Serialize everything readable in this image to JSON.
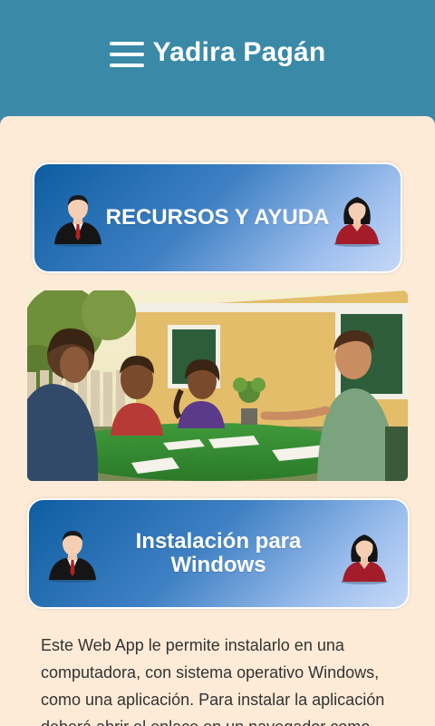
{
  "header": {
    "title": "Yadira Pagán",
    "menu_icon": "menu-icon",
    "background": "#3a89a7"
  },
  "buttons": {
    "resources": {
      "label": "RECURSOS Y AYUDA",
      "left_icon": "man-avatar-icon",
      "right_icon": "woman-avatar-icon"
    },
    "windows": {
      "label": "Instalación para Windows",
      "left_icon": "man-avatar-icon",
      "right_icon": "woman-avatar-icon"
    }
  },
  "image": {
    "name": "family-study-scene-image"
  },
  "description": {
    "text": "Este Web App le permite instalarlo en una computadora, con sistema operativo Windows, como una aplicación. Para instalar la aplicación deberá abrir el enlace en un navegador como"
  },
  "colors": {
    "page_background": "#fdebd7",
    "button_gradient_start": "#0e5da1",
    "button_gradient_end": "#c6d9f7"
  }
}
